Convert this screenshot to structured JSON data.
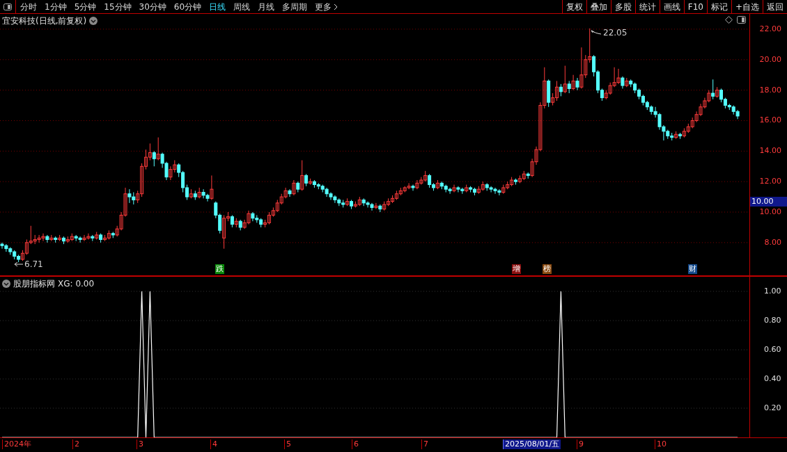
{
  "toolbar": {
    "periods": [
      {
        "label": "分时",
        "selected": false
      },
      {
        "label": "1分钟",
        "selected": false
      },
      {
        "label": "5分钟",
        "selected": false
      },
      {
        "label": "15分钟",
        "selected": false
      },
      {
        "label": "30分钟",
        "selected": false
      },
      {
        "label": "60分钟",
        "selected": false
      },
      {
        "label": "日线",
        "selected": true
      },
      {
        "label": "周线",
        "selected": false
      },
      {
        "label": "月线",
        "selected": false
      },
      {
        "label": "多周期",
        "selected": false
      }
    ],
    "more": "更多",
    "actions": [
      "复权",
      "叠加",
      "多股",
      "统计",
      "画线",
      "F10",
      "标记",
      "+自选",
      "返回"
    ]
  },
  "main_chart": {
    "title": "宜安科技(日线,前复权)",
    "current_price": "10.00",
    "high_label": "22.05",
    "low_label": "6.71",
    "chart_data": {
      "type": "candlestick",
      "ylim": [
        5.85,
        23.0
      ],
      "grid": true,
      "yticks": [
        {
          "value": 8,
          "label": "8.00"
        },
        {
          "value": 10,
          "label": "10.00"
        },
        {
          "value": 12,
          "label": "12.00"
        },
        {
          "value": 14,
          "label": "14.00"
        },
        {
          "value": 16,
          "label": "16.00"
        },
        {
          "value": 18,
          "label": "18.00"
        },
        {
          "value": 20,
          "label": "20.00"
        },
        {
          "value": 22,
          "label": "22.00"
        }
      ],
      "ohlc": [
        [
          7.9,
          8.0,
          7.6,
          7.8
        ],
        [
          7.8,
          7.9,
          7.4,
          7.6
        ],
        [
          7.6,
          7.7,
          7.2,
          7.4
        ],
        [
          7.4,
          7.5,
          6.9,
          7.1
        ],
        [
          7.1,
          7.2,
          6.71,
          6.9
        ],
        [
          6.9,
          7.5,
          6.8,
          7.3
        ],
        [
          7.3,
          8.2,
          7.2,
          8.0
        ],
        [
          8.0,
          9.1,
          7.9,
          8.1
        ],
        [
          8.1,
          8.5,
          7.9,
          8.2
        ],
        [
          8.2,
          8.5,
          8.0,
          8.3
        ],
        [
          8.3,
          8.6,
          8.1,
          8.4
        ],
        [
          8.4,
          8.5,
          8.0,
          8.2
        ],
        [
          8.2,
          8.5,
          8.1,
          8.3
        ],
        [
          8.3,
          8.4,
          8.0,
          8.2
        ],
        [
          8.2,
          8.5,
          8.1,
          8.3
        ],
        [
          8.3,
          8.4,
          7.9,
          8.1
        ],
        [
          8.1,
          8.4,
          8.0,
          8.2
        ],
        [
          8.2,
          8.6,
          8.1,
          8.4
        ],
        [
          8.4,
          8.5,
          8.1,
          8.3
        ],
        [
          8.3,
          8.4,
          8.0,
          8.2
        ],
        [
          8.2,
          8.5,
          8.1,
          8.3
        ],
        [
          8.3,
          8.6,
          8.2,
          8.4
        ],
        [
          8.4,
          8.5,
          8.1,
          8.3
        ],
        [
          8.3,
          8.7,
          8.2,
          8.5
        ],
        [
          8.5,
          8.6,
          8.0,
          8.2
        ],
        [
          8.2,
          8.5,
          8.1,
          8.3
        ],
        [
          8.3,
          8.8,
          8.2,
          8.6
        ],
        [
          8.6,
          8.7,
          8.3,
          8.5
        ],
        [
          8.5,
          9.1,
          8.4,
          8.9
        ],
        [
          8.9,
          10.0,
          8.8,
          9.8
        ],
        [
          9.8,
          11.6,
          9.7,
          11.2
        ],
        [
          11.2,
          11.5,
          10.6,
          11.0
        ],
        [
          11.0,
          11.3,
          10.5,
          10.8
        ],
        [
          10.8,
          11.4,
          10.6,
          11.2
        ],
        [
          11.2,
          13.2,
          11.0,
          13.0
        ],
        [
          13.0,
          14.1,
          12.8,
          13.6
        ],
        [
          13.6,
          14.5,
          13.4,
          13.9
        ],
        [
          13.9,
          14.0,
          13.0,
          13.5
        ],
        [
          13.5,
          14.9,
          13.4,
          13.8
        ],
        [
          13.8,
          13.9,
          12.9,
          13.2
        ],
        [
          13.2,
          13.3,
          12.1,
          12.3
        ],
        [
          12.3,
          13.0,
          12.1,
          12.8
        ],
        [
          12.8,
          13.4,
          12.6,
          13.1
        ],
        [
          13.1,
          13.2,
          12.3,
          12.6
        ],
        [
          12.6,
          12.7,
          11.3,
          11.6
        ],
        [
          11.6,
          11.8,
          10.8,
          11.0
        ],
        [
          11.0,
          11.5,
          10.9,
          11.2
        ],
        [
          11.2,
          11.4,
          10.8,
          11.0
        ],
        [
          11.0,
          11.6,
          10.9,
          11.3
        ],
        [
          11.3,
          11.5,
          10.9,
          11.1
        ],
        [
          11.1,
          11.2,
          10.7,
          10.9
        ],
        [
          10.9,
          12.4,
          10.8,
          11.5
        ],
        [
          10.6,
          10.7,
          9.6,
          9.8
        ],
        [
          9.8,
          9.9,
          8.6,
          8.8
        ],
        [
          8.3,
          9.8,
          7.6,
          9.6
        ],
        [
          9.6,
          10.0,
          9.4,
          9.7
        ],
        [
          9.7,
          9.8,
          9.0,
          9.2
        ],
        [
          9.2,
          9.6,
          9.0,
          9.4
        ],
        [
          9.4,
          9.5,
          8.8,
          9.0
        ],
        [
          9.0,
          9.5,
          8.9,
          9.3
        ],
        [
          9.3,
          10.1,
          9.2,
          9.9
        ],
        [
          9.9,
          10.0,
          9.4,
          9.6
        ],
        [
          9.6,
          9.8,
          9.3,
          9.5
        ],
        [
          9.5,
          9.6,
          9.0,
          9.2
        ],
        [
          9.2,
          9.5,
          9.0,
          9.3
        ],
        [
          9.3,
          10.0,
          9.2,
          9.8
        ],
        [
          9.8,
          10.3,
          9.7,
          10.1
        ],
        [
          10.1,
          10.8,
          10.0,
          10.6
        ],
        [
          10.6,
          11.2,
          10.5,
          11.0
        ],
        [
          11.0,
          11.6,
          10.9,
          11.4
        ],
        [
          11.4,
          11.5,
          11.0,
          11.2
        ],
        [
          11.2,
          12.1,
          11.1,
          11.9
        ],
        [
          11.9,
          12.0,
          11.3,
          11.5
        ],
        [
          11.5,
          13.4,
          11.4,
          12.4
        ],
        [
          12.4,
          12.5,
          11.7,
          11.9
        ],
        [
          11.9,
          12.2,
          11.8,
          12.0
        ],
        [
          12.0,
          12.1,
          11.6,
          11.8
        ],
        [
          11.8,
          11.9,
          11.5,
          11.7
        ],
        [
          11.7,
          11.8,
          11.3,
          11.5
        ],
        [
          11.5,
          11.6,
          11.0,
          11.2
        ],
        [
          11.2,
          11.3,
          10.8,
          11.0
        ],
        [
          11.0,
          11.1,
          10.6,
          10.8
        ],
        [
          10.8,
          10.9,
          10.4,
          10.6
        ],
        [
          10.6,
          10.8,
          10.3,
          10.5
        ],
        [
          10.5,
          10.9,
          10.4,
          10.7
        ],
        [
          10.7,
          10.8,
          10.2,
          10.4
        ],
        [
          10.4,
          10.7,
          10.3,
          10.5
        ],
        [
          10.5,
          11.0,
          10.4,
          10.8
        ],
        [
          10.8,
          10.9,
          10.4,
          10.6
        ],
        [
          10.6,
          10.7,
          10.3,
          10.5
        ],
        [
          10.5,
          10.6,
          10.1,
          10.3
        ],
        [
          10.3,
          10.6,
          10.2,
          10.4
        ],
        [
          10.4,
          10.5,
          10.0,
          10.2
        ],
        [
          10.2,
          10.7,
          10.1,
          10.5
        ],
        [
          10.5,
          10.9,
          10.4,
          10.7
        ],
        [
          10.7,
          11.1,
          10.6,
          10.9
        ],
        [
          10.9,
          11.4,
          10.8,
          11.2
        ],
        [
          11.2,
          11.6,
          11.1,
          11.4
        ],
        [
          11.4,
          11.7,
          11.3,
          11.6
        ],
        [
          11.6,
          11.9,
          11.5,
          11.7
        ],
        [
          11.7,
          11.8,
          11.4,
          11.6
        ],
        [
          11.6,
          12.1,
          11.5,
          11.9
        ],
        [
          11.9,
          12.3,
          11.8,
          12.1
        ],
        [
          12.1,
          12.7,
          12.0,
          12.4
        ],
        [
          12.4,
          12.5,
          11.6,
          11.8
        ],
        [
          11.8,
          11.9,
          11.4,
          11.6
        ],
        [
          11.6,
          12.1,
          11.5,
          11.9
        ],
        [
          11.9,
          12.0,
          11.5,
          11.7
        ],
        [
          11.7,
          11.8,
          11.3,
          11.5
        ],
        [
          11.5,
          11.6,
          11.2,
          11.4
        ],
        [
          11.4,
          11.8,
          11.3,
          11.6
        ],
        [
          11.6,
          11.7,
          11.3,
          11.5
        ],
        [
          11.5,
          11.6,
          11.2,
          11.4
        ],
        [
          11.4,
          11.8,
          11.3,
          11.6
        ],
        [
          11.6,
          11.7,
          11.3,
          11.5
        ],
        [
          11.5,
          11.6,
          11.1,
          11.3
        ],
        [
          11.3,
          11.7,
          11.2,
          11.5
        ],
        [
          11.5,
          12.0,
          11.4,
          11.8
        ],
        [
          11.8,
          11.9,
          11.4,
          11.6
        ],
        [
          11.6,
          11.7,
          11.3,
          11.5
        ],
        [
          11.5,
          11.6,
          11.2,
          11.4
        ],
        [
          11.4,
          11.5,
          11.1,
          11.3
        ],
        [
          11.3,
          11.8,
          11.2,
          11.6
        ],
        [
          11.6,
          12.0,
          11.5,
          11.8
        ],
        [
          11.8,
          12.3,
          11.7,
          12.1
        ],
        [
          12.1,
          12.2,
          11.8,
          12.0
        ],
        [
          12.0,
          12.4,
          11.9,
          12.2
        ],
        [
          12.2,
          12.7,
          12.1,
          12.5
        ],
        [
          12.5,
          12.6,
          12.2,
          12.4
        ],
        [
          12.4,
          13.5,
          12.3,
          13.3
        ],
        [
          13.3,
          14.3,
          13.1,
          14.1
        ],
        [
          14.1,
          17.2,
          14.0,
          17.0
        ],
        [
          17.0,
          19.5,
          16.8,
          18.6
        ],
        [
          18.6,
          18.7,
          16.9,
          17.2
        ],
        [
          17.2,
          17.8,
          17.0,
          17.5
        ],
        [
          17.5,
          18.6,
          17.3,
          18.2
        ],
        [
          18.2,
          18.4,
          17.6,
          17.9
        ],
        [
          17.9,
          19.6,
          17.8,
          18.4
        ],
        [
          18.4,
          18.6,
          17.8,
          18.1
        ],
        [
          18.1,
          19.0,
          18.0,
          18.6
        ],
        [
          18.6,
          18.8,
          18.0,
          18.2
        ],
        [
          18.2,
          20.8,
          18.1,
          19.0
        ],
        [
          19.0,
          20.3,
          18.8,
          20.0
        ],
        [
          20.0,
          22.05,
          19.8,
          20.2
        ],
        [
          20.2,
          20.3,
          18.9,
          19.2
        ],
        [
          19.2,
          19.3,
          17.8,
          18.0
        ],
        [
          18.0,
          18.1,
          17.3,
          17.5
        ],
        [
          17.5,
          18.0,
          17.4,
          17.8
        ],
        [
          17.8,
          18.5,
          17.7,
          18.3
        ],
        [
          18.3,
          19.5,
          18.2,
          18.5
        ],
        [
          18.5,
          19.4,
          18.4,
          18.8
        ],
        [
          18.8,
          18.9,
          18.1,
          18.3
        ],
        [
          18.3,
          18.8,
          18.2,
          18.6
        ],
        [
          18.6,
          18.7,
          18.2,
          18.4
        ],
        [
          18.4,
          18.5,
          17.8,
          18.0
        ],
        [
          18.0,
          18.1,
          17.4,
          17.6
        ],
        [
          17.6,
          17.7,
          17.0,
          17.2
        ],
        [
          17.2,
          17.3,
          16.7,
          16.9
        ],
        [
          16.9,
          17.0,
          16.4,
          16.6
        ],
        [
          16.6,
          16.9,
          16.2,
          16.4
        ],
        [
          16.4,
          16.5,
          15.4,
          15.6
        ],
        [
          15.6,
          15.7,
          14.7,
          15.3
        ],
        [
          15.3,
          15.4,
          14.8,
          15.0
        ],
        [
          15.0,
          15.2,
          14.7,
          14.9
        ],
        [
          14.9,
          15.3,
          14.8,
          15.1
        ],
        [
          15.1,
          15.2,
          14.8,
          15.0
        ],
        [
          15.0,
          15.5,
          14.9,
          15.3
        ],
        [
          15.3,
          15.8,
          15.2,
          15.6
        ],
        [
          15.6,
          16.2,
          15.5,
          16.0
        ],
        [
          16.0,
          16.6,
          15.9,
          16.4
        ],
        [
          16.4,
          17.1,
          16.3,
          16.9
        ],
        [
          16.9,
          17.5,
          16.8,
          17.3
        ],
        [
          17.3,
          18.0,
          17.2,
          17.8
        ],
        [
          17.8,
          18.7,
          17.4,
          17.6
        ],
        [
          17.6,
          18.2,
          17.5,
          18.0
        ],
        [
          18.0,
          18.1,
          17.2,
          17.4
        ],
        [
          17.4,
          17.5,
          16.8,
          17.0
        ],
        [
          17.0,
          17.1,
          16.7,
          16.9
        ],
        [
          16.9,
          17.0,
          16.4,
          16.6
        ],
        [
          16.6,
          16.7,
          16.1,
          16.3
        ]
      ]
    },
    "events": [
      {
        "text": "跌",
        "color": "#0a8a0a"
      },
      {
        "text": "增",
        "color": "#8c1010"
      },
      {
        "text": "榜",
        "color": "#8a4a10"
      },
      {
        "text": "财",
        "color": "#144a8c"
      }
    ]
  },
  "indicator": {
    "title": "股朋指标网",
    "value_label": "XG: 0.00",
    "chart_data": {
      "type": "line",
      "ylim": [
        0,
        1.1
      ],
      "grid": true,
      "yticks": [
        {
          "value": 1,
          "label": "1.00"
        },
        {
          "value": 0.8,
          "label": "0.80"
        },
        {
          "value": 0.6,
          "label": "0.60"
        },
        {
          "value": 0.4,
          "label": "0.40"
        },
        {
          "value": 0.2,
          "label": "0.20"
        }
      ],
      "series": [
        {
          "color": "#ffffff",
          "values": [
            0,
            0,
            0,
            0,
            0,
            0,
            0,
            0,
            0,
            0,
            0,
            0,
            0,
            0,
            0,
            0,
            0,
            0,
            0,
            0,
            0,
            0,
            0,
            0,
            0,
            0,
            0,
            0,
            0,
            0,
            0,
            0,
            0,
            0,
            1,
            0,
            1,
            0,
            0,
            0,
            0,
            0,
            0,
            0,
            0,
            0,
            0,
            0,
            0,
            0,
            0,
            0,
            0,
            0,
            0,
            0,
            0,
            0,
            0,
            0,
            0,
            0,
            0,
            0,
            0,
            0,
            0,
            0,
            0,
            0,
            0,
            0,
            0,
            0,
            0,
            0,
            0,
            0,
            0,
            0,
            0,
            0,
            0,
            0,
            0,
            0,
            0,
            0,
            0,
            0,
            0,
            0,
            0,
            0,
            0,
            0,
            0,
            0,
            0,
            0,
            0,
            0,
            0,
            0,
            0,
            0,
            0,
            0,
            0,
            0,
            0,
            0,
            0,
            0,
            0,
            0,
            0,
            0,
            0,
            0,
            0,
            0,
            0,
            0,
            0,
            0,
            0,
            0,
            0,
            0,
            0,
            0,
            0,
            0,
            0,
            0,
            1,
            0,
            0,
            0,
            0,
            0,
            0,
            0,
            0,
            0,
            0,
            0,
            0,
            0,
            0,
            0,
            0,
            0,
            0,
            0,
            0,
            0,
            0,
            0,
            0,
            0,
            0,
            0,
            0,
            0,
            0,
            0,
            0,
            0,
            0,
            0,
            0,
            0,
            0,
            0,
            0,
            0,
            0,
            0
          ]
        }
      ]
    }
  },
  "time_axis": {
    "labels": [
      {
        "text": "2024年",
        "highlighted": false
      },
      {
        "text": "2",
        "highlighted": false
      },
      {
        "text": "3",
        "highlighted": false
      },
      {
        "text": "4",
        "highlighted": false
      },
      {
        "text": "5",
        "highlighted": false
      },
      {
        "text": "6",
        "highlighted": false
      },
      {
        "text": "7",
        "highlighted": false
      },
      {
        "text": "2025/08/01/五",
        "highlighted": true
      },
      {
        "text": "9",
        "highlighted": false
      },
      {
        "text": "10",
        "highlighted": false
      }
    ]
  }
}
